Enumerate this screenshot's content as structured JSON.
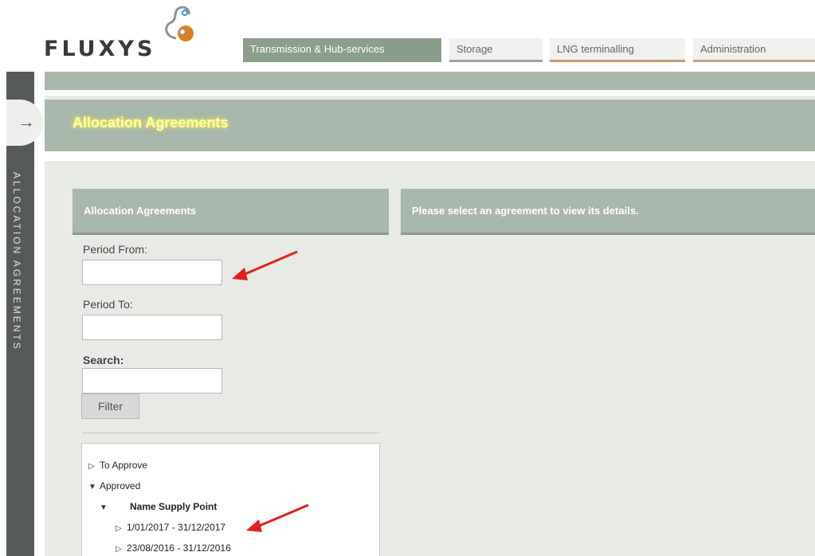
{
  "logo": {
    "text": "FLUXYS",
    "icon": "fluxys-logo-mark"
  },
  "tabs": [
    {
      "label": "Transmission & Hub-services",
      "active": true,
      "color": "#8a9e8b"
    },
    {
      "label": "Storage",
      "active": false,
      "color": "#9aa3a8"
    },
    {
      "label": "LNG terminalling",
      "active": false,
      "color": "#c79a6e"
    },
    {
      "label": "Administration",
      "active": false,
      "color": "#c9a487"
    }
  ],
  "side_panel": {
    "label": "ALLOCATION AGREEMENTS",
    "expand_icon": "arrow-right-icon"
  },
  "page": {
    "title": "Allocation Agreements"
  },
  "list_panel": {
    "title": "Allocation Agreements"
  },
  "detail_panel": {
    "message": "Please select an agreement to view its details."
  },
  "filters": {
    "period_from_label": "Period From:",
    "period_from_value": "",
    "period_to_label": "Period To:",
    "period_to_value": "",
    "search_label": "Search:",
    "search_value": "",
    "filter_button": "Filter"
  },
  "tree": {
    "to_approve": "To Approve",
    "approved": "Approved",
    "supply_point": "Name Supply Point",
    "periods": [
      "1/01/2017 - 31/12/2017",
      "23/08/2016 - 31/12/2016"
    ]
  },
  "colors": {
    "accent": "#a9b8ac",
    "background": "#e7eae5",
    "sidebar": "#565a5a",
    "annotation_arrow": "#e02020"
  }
}
